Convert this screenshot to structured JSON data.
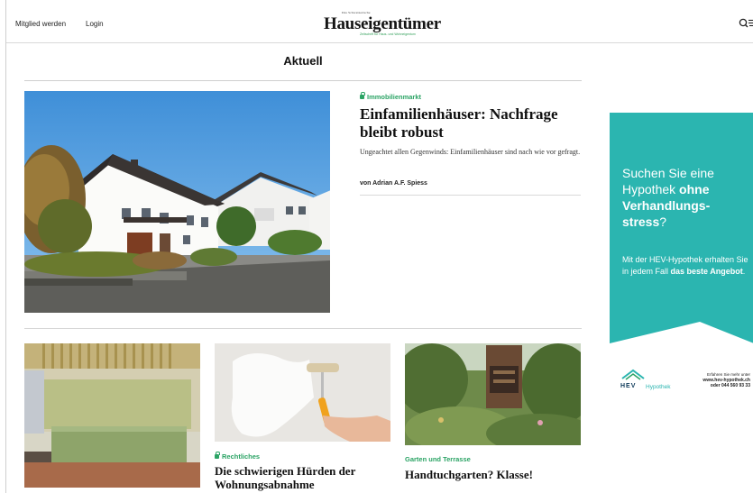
{
  "header": {
    "nav": {
      "member": "Mitglied werden",
      "login": "Login"
    },
    "logo": {
      "top_line": "Das Schweizerische",
      "name": "Hauseigentümer",
      "sub_line": "Zeitschrift für Haus- und Wohneigentum"
    }
  },
  "section": {
    "title": "Aktuell"
  },
  "hero": {
    "kicker": "Immobilienmarkt",
    "title": "Einfamilienhäuser: Nachfrage bleibt robust",
    "lead": "Ungeachtet allen Gegenwinds: Einfamilienhäuser sind nach wie vor gefragt.",
    "author": "von Adrian A.F. Spiess"
  },
  "cards": [
    {
      "kicker": "",
      "title": ""
    },
    {
      "kicker": "Rechtliches",
      "title": "Die schwierigen Hürden der Wohnungsabnahme"
    },
    {
      "kicker": "Garten und Terrasse",
      "title": "Handtuchgarten? Klasse!"
    }
  ],
  "ad": {
    "head_1": "Suchen Sie eine Hypothek ",
    "head_bold": "ohne Verhandlungs­stress",
    "head_end": "?",
    "body_1": "Mit der HEV-Hypothek erhalten Sie in jedem Fall ",
    "body_bold": "das beste Angebot",
    "body_end": ".",
    "brand": "HEV",
    "brand_sub": "Hypothek",
    "small_1": "Erfahren Sie mehr unter",
    "small_url": "www.hev-hypothek.ch",
    "small_tel": "oder 044 560 93 33",
    "colors": {
      "bg": "#2bb5b0"
    }
  },
  "colors": {
    "accent_green": "#2aa364"
  }
}
